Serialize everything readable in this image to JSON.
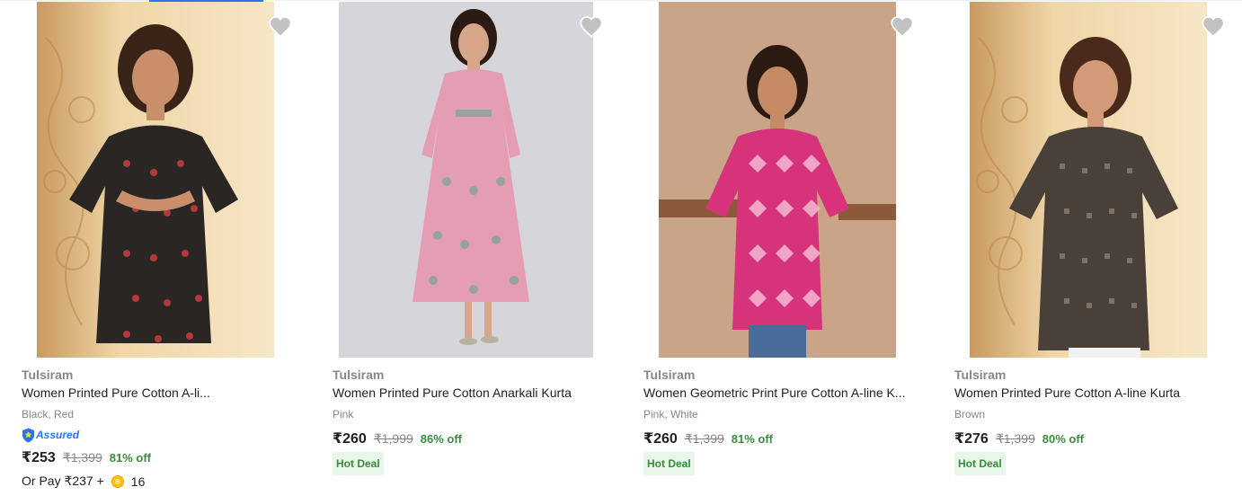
{
  "products": [
    {
      "brand": "Tulsiram",
      "title": "Women Printed Pure Cotton A-li...",
      "color": "Black, Red",
      "assured_label": "Assured",
      "price": "₹253",
      "mrp": "₹1,399",
      "discount": "81% off",
      "or_pay_label": "Or Pay ₹237 +",
      "coins": "16",
      "image_desc": "woman-black-red-kurta"
    },
    {
      "brand": "Tulsiram",
      "title": "Women Printed Pure Cotton Anarkali Kurta",
      "color": "Pink",
      "price": "₹260",
      "mrp": "₹1,999",
      "discount": "86% off",
      "badge": "Hot Deal",
      "image_desc": "woman-pink-anarkali-kurta"
    },
    {
      "brand": "Tulsiram",
      "title": "Women Geometric Print Pure Cotton A-line K...",
      "color": "Pink, White",
      "price": "₹260",
      "mrp": "₹1,399",
      "discount": "81% off",
      "badge": "Hot Deal",
      "image_desc": "woman-pink-geometric-kurta"
    },
    {
      "brand": "Tulsiram",
      "title": "Women Printed Pure Cotton A-line Kurta",
      "color": "Brown",
      "price": "₹276",
      "mrp": "₹1,399",
      "discount": "80% off",
      "badge": "Hot Deal",
      "image_desc": "woman-brown-kurta"
    }
  ],
  "colors": {
    "accent": "#2874f0",
    "discount_green": "#388e3c",
    "muted_text": "#878787",
    "hot_deal_bg": "#e8f5e9"
  }
}
